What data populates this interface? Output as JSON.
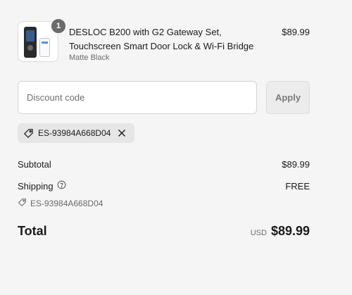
{
  "cart": {
    "item": {
      "quantity": "1",
      "title": "DESLOC B200 with G2 Gateway Set, Touchscreen Smart Door Lock & Wi-Fi Bridge",
      "variant": "Matte Black",
      "price": "$89.99"
    }
  },
  "discount": {
    "placeholder": "Discount code",
    "apply_label": "Apply",
    "applied_code": "ES-93984A668D04"
  },
  "summary": {
    "subtotal_label": "Subtotal",
    "subtotal_value": "$89.99",
    "shipping_label": "Shipping",
    "shipping_value": "FREE",
    "applied_code": "ES-93984A668D04",
    "total_label": "Total",
    "currency": "USD",
    "total_value": "$89.99"
  },
  "icons": {
    "tag": "tag-icon",
    "close": "close-icon",
    "help": "help-circle-icon"
  }
}
